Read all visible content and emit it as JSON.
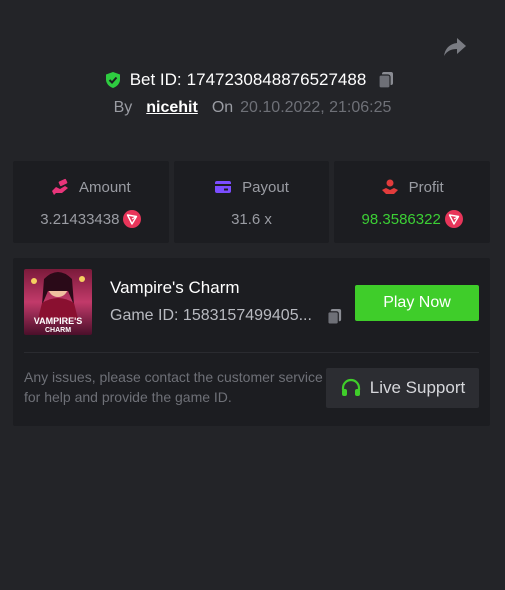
{
  "header": {
    "bet_label": "Bet ID:",
    "bet_id": "1747230848876527488",
    "by_label": "By",
    "username": "nicehit",
    "on_label": "On",
    "datetime": "20.10.2022, 21:06:25"
  },
  "stats": [
    {
      "label": "Amount",
      "value": "3.21433438",
      "icon": "dollar-hand-icon",
      "icon_color": "#e8357a",
      "currency_icon": "trx-icon"
    },
    {
      "label": "Payout",
      "value": "31.6 x",
      "icon": "card-icon",
      "icon_color": "#7b4dff"
    },
    {
      "label": "Profit",
      "value": "98.3586322",
      "icon": "profit-hand-icon",
      "icon_color": "#e23c3c",
      "value_color": "#3ccf35",
      "currency_icon": "trx-icon"
    }
  ],
  "game": {
    "name": "Vampire's Charm",
    "id_label": "Game ID:",
    "id_value": "1583157499405...",
    "thumb_text_1": "VAMPIRE'S",
    "thumb_text_2": "CHARM",
    "play_label": "Play Now",
    "help_text": "Any issues, please contact the customer service for help and provide the game ID.",
    "support_label": "Live Support"
  },
  "colors": {
    "background": "#232428",
    "card": "#1c1d21",
    "accent_green": "#3fcd2a",
    "trx_red": "#e8355a"
  }
}
